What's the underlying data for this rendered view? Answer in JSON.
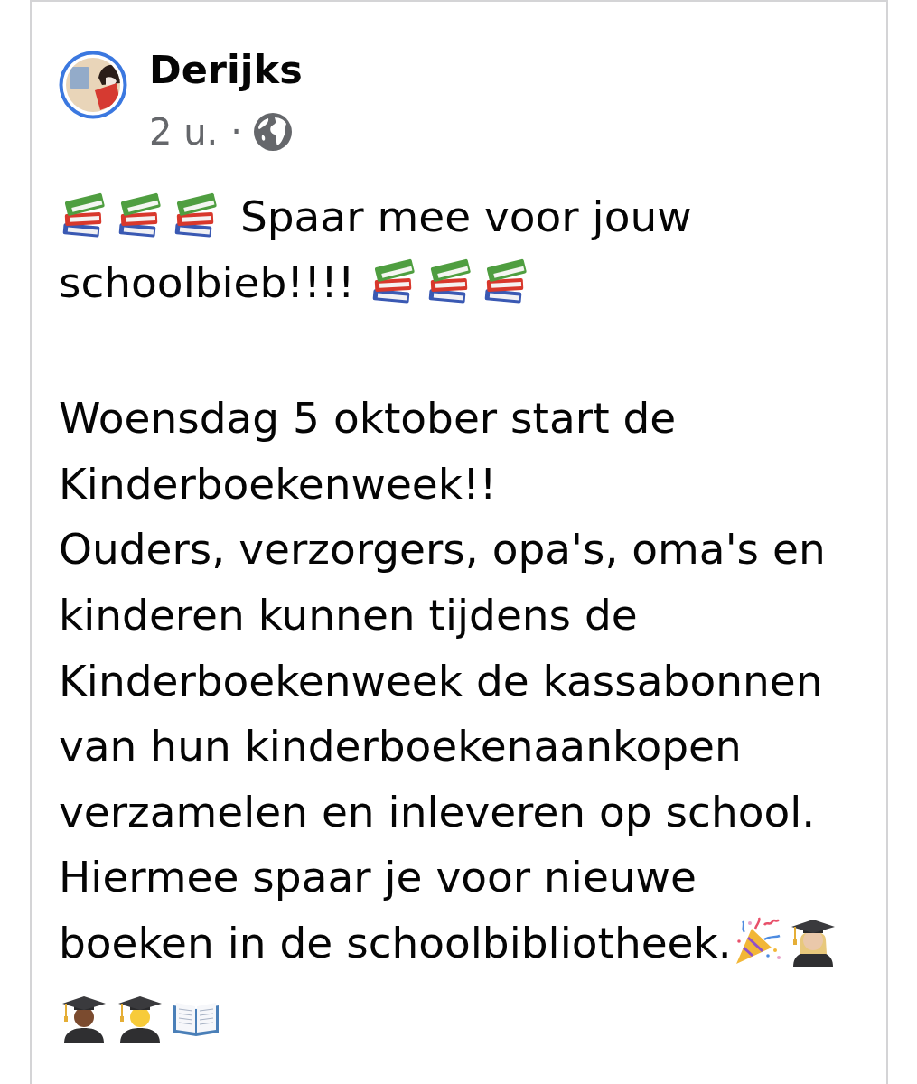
{
  "post": {
    "author": {
      "name": "Derijks"
    },
    "meta": {
      "time": "2 u.",
      "separator": "·"
    },
    "paragraphs": [
      {
        "lines": [
          [
            {
              "kind": "books"
            },
            {
              "kind": "books"
            },
            {
              "kind": "books"
            },
            {
              "kind": "text",
              "text": " Spaar mee voor jouw"
            }
          ],
          [
            {
              "kind": "text",
              "text": "schoolbieb!!!! "
            },
            {
              "kind": "books"
            },
            {
              "kind": "books"
            },
            {
              "kind": "books"
            }
          ]
        ]
      },
      {
        "lines": [
          [
            {
              "kind": "text",
              "text": "Woensdag 5 oktober start de Kinderboekenweek!!"
            }
          ],
          [
            {
              "kind": "text",
              "text": "Ouders, verzorgers, opa's, oma's en kinderen kunnen tijdens de Kinderboekenweek de kassabonnen van hun kinderboekenaankopen verzamelen en inleveren op school. Hiermee spaar je voor nieuwe"
            }
          ],
          [
            {
              "kind": "text",
              "text": "boeken in de schoolbibliotheek."
            },
            {
              "kind": "party-popper"
            },
            {
              "kind": "graduate-woman"
            }
          ],
          [
            {
              "kind": "graduate-man"
            },
            {
              "kind": "graduate-person"
            },
            {
              "kind": "open-book"
            }
          ]
        ]
      }
    ]
  }
}
